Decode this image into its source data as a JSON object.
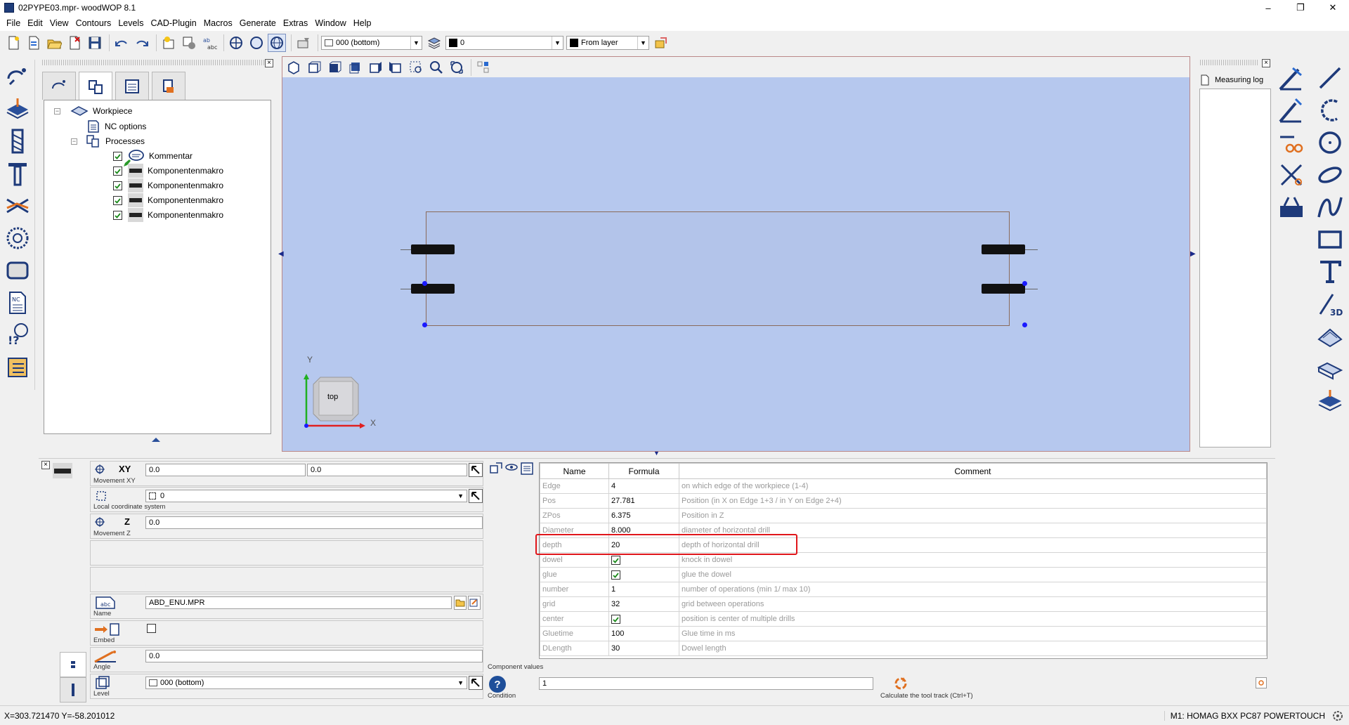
{
  "window": {
    "title": "02PYPE03.mpr- woodWOP 8.1",
    "minimize": "–",
    "restore": "❐",
    "close": "✕"
  },
  "menu": [
    "File",
    "Edit",
    "View",
    "Contours",
    "Levels",
    "CAD-Plugin",
    "Macros",
    "Generate",
    "Extras",
    "Window",
    "Help"
  ],
  "toolbar": {
    "level_combo": "000  (bottom)",
    "color_combo": "0",
    "layer_combo": "From layer"
  },
  "tree": {
    "root": "Workpiece",
    "nc_options": "NC options",
    "processes": "Processes",
    "items": [
      {
        "label": "Kommentar",
        "checked": true,
        "icon": "comment-icon"
      },
      {
        "label": "Komponentenmakro",
        "checked": true,
        "icon": "component-macro-icon"
      },
      {
        "label": "Komponentenmakro",
        "checked": true,
        "icon": "component-macro-icon"
      },
      {
        "label": "Komponentenmakro",
        "checked": true,
        "icon": "component-macro-icon"
      },
      {
        "label": "Komponentenmakro",
        "checked": true,
        "icon": "component-macro-icon"
      }
    ]
  },
  "viewport": {
    "cube_label": "top",
    "axis_x": "X",
    "axis_y": "Y"
  },
  "measuring_log": {
    "title": "Measuring log"
  },
  "properties": {
    "movement_xy": {
      "axis": "XY",
      "label": "Movement XY",
      "x": "0.0",
      "y": "0.0"
    },
    "local_cs": {
      "label": "Local coordinate system",
      "value": "0"
    },
    "movement_z": {
      "axis": "Z",
      "label": "Movement Z",
      "value": "0.0"
    },
    "name": {
      "label": "Name",
      "value": "ABD_ENU.MPR"
    },
    "embed": {
      "label": "Embed"
    },
    "angle": {
      "label": "Angle",
      "value": "0.0"
    },
    "level": {
      "label": "Level",
      "value": "000 (bottom)"
    }
  },
  "params": {
    "headers": {
      "name": "Name",
      "formula": "Formula",
      "comment": "Comment"
    },
    "rows": [
      {
        "name": "Edge",
        "formula": "4",
        "comment": "on which edge of the workpiece (1-4)"
      },
      {
        "name": "Pos",
        "formula": "27.781",
        "comment": "Position (in X on Edge 1+3 / in Y on Edge 2+4)"
      },
      {
        "name": "ZPos",
        "formula": "6.375",
        "comment": "Position in Z"
      },
      {
        "name": "Diameter",
        "formula": "8.000",
        "comment": "diameter of horizontal drill"
      },
      {
        "name": "depth",
        "formula": "20",
        "comment": "depth of horizontal drill"
      },
      {
        "name": "dowel",
        "formula": "",
        "checkbox": true,
        "comment": "knock in dowel"
      },
      {
        "name": "glue",
        "formula": "",
        "checkbox": true,
        "comment": "glue the dowel"
      },
      {
        "name": "number",
        "formula": "1",
        "comment": "number of operations (min 1/ max 10)"
      },
      {
        "name": "grid",
        "formula": "32",
        "comment": "grid between operations"
      },
      {
        "name": "center",
        "formula": "",
        "checkbox": true,
        "comment": "position is center of multiple drills"
      },
      {
        "name": "Gluetime",
        "formula": "100",
        "comment": "Glue time in ms"
      },
      {
        "name": "DLength",
        "formula": "30",
        "comment": "Dowel length"
      }
    ],
    "component_values_label": "Component values"
  },
  "condition": {
    "label": "Condition",
    "value": "1",
    "icon_glyph": "?"
  },
  "calc": {
    "label": "Calculate the tool track (Ctrl+T)"
  },
  "status": {
    "coords": "X=303.721470 Y=-58.201012",
    "machine": "M1: HOMAG BXX PC87 POWERTOUCH"
  },
  "colors": {
    "viewport_bg": "#b6c8ee",
    "highlight": "#e0161b",
    "handle": "#1a1aff"
  }
}
